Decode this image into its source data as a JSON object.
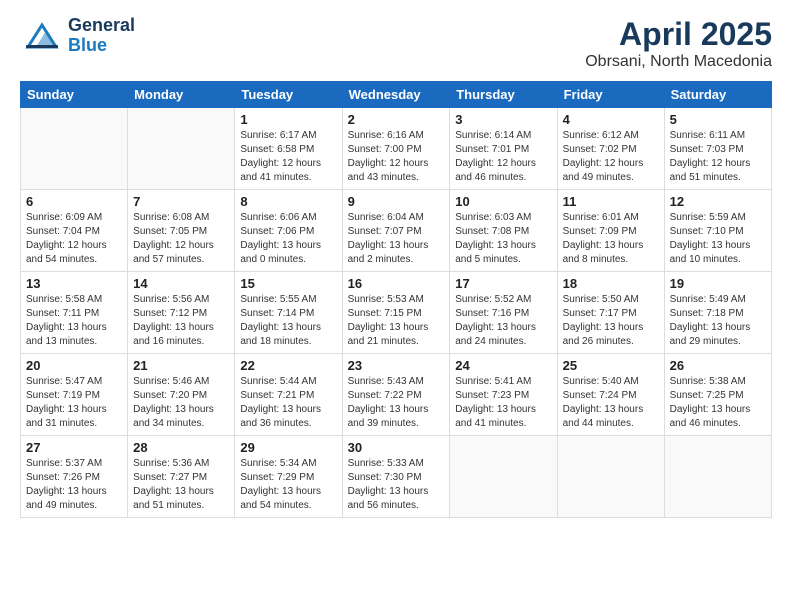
{
  "header": {
    "logo_general": "General",
    "logo_blue": "Blue",
    "month_title": "April 2025",
    "location": "Obrsani, North Macedonia"
  },
  "calendar": {
    "days_of_week": [
      "Sunday",
      "Monday",
      "Tuesday",
      "Wednesday",
      "Thursday",
      "Friday",
      "Saturday"
    ],
    "weeks": [
      [
        {
          "num": "",
          "detail": ""
        },
        {
          "num": "",
          "detail": ""
        },
        {
          "num": "1",
          "detail": "Sunrise: 6:17 AM\nSunset: 6:58 PM\nDaylight: 12 hours\nand 41 minutes."
        },
        {
          "num": "2",
          "detail": "Sunrise: 6:16 AM\nSunset: 7:00 PM\nDaylight: 12 hours\nand 43 minutes."
        },
        {
          "num": "3",
          "detail": "Sunrise: 6:14 AM\nSunset: 7:01 PM\nDaylight: 12 hours\nand 46 minutes."
        },
        {
          "num": "4",
          "detail": "Sunrise: 6:12 AM\nSunset: 7:02 PM\nDaylight: 12 hours\nand 49 minutes."
        },
        {
          "num": "5",
          "detail": "Sunrise: 6:11 AM\nSunset: 7:03 PM\nDaylight: 12 hours\nand 51 minutes."
        }
      ],
      [
        {
          "num": "6",
          "detail": "Sunrise: 6:09 AM\nSunset: 7:04 PM\nDaylight: 12 hours\nand 54 minutes."
        },
        {
          "num": "7",
          "detail": "Sunrise: 6:08 AM\nSunset: 7:05 PM\nDaylight: 12 hours\nand 57 minutes."
        },
        {
          "num": "8",
          "detail": "Sunrise: 6:06 AM\nSunset: 7:06 PM\nDaylight: 13 hours\nand 0 minutes."
        },
        {
          "num": "9",
          "detail": "Sunrise: 6:04 AM\nSunset: 7:07 PM\nDaylight: 13 hours\nand 2 minutes."
        },
        {
          "num": "10",
          "detail": "Sunrise: 6:03 AM\nSunset: 7:08 PM\nDaylight: 13 hours\nand 5 minutes."
        },
        {
          "num": "11",
          "detail": "Sunrise: 6:01 AM\nSunset: 7:09 PM\nDaylight: 13 hours\nand 8 minutes."
        },
        {
          "num": "12",
          "detail": "Sunrise: 5:59 AM\nSunset: 7:10 PM\nDaylight: 13 hours\nand 10 minutes."
        }
      ],
      [
        {
          "num": "13",
          "detail": "Sunrise: 5:58 AM\nSunset: 7:11 PM\nDaylight: 13 hours\nand 13 minutes."
        },
        {
          "num": "14",
          "detail": "Sunrise: 5:56 AM\nSunset: 7:12 PM\nDaylight: 13 hours\nand 16 minutes."
        },
        {
          "num": "15",
          "detail": "Sunrise: 5:55 AM\nSunset: 7:14 PM\nDaylight: 13 hours\nand 18 minutes."
        },
        {
          "num": "16",
          "detail": "Sunrise: 5:53 AM\nSunset: 7:15 PM\nDaylight: 13 hours\nand 21 minutes."
        },
        {
          "num": "17",
          "detail": "Sunrise: 5:52 AM\nSunset: 7:16 PM\nDaylight: 13 hours\nand 24 minutes."
        },
        {
          "num": "18",
          "detail": "Sunrise: 5:50 AM\nSunset: 7:17 PM\nDaylight: 13 hours\nand 26 minutes."
        },
        {
          "num": "19",
          "detail": "Sunrise: 5:49 AM\nSunset: 7:18 PM\nDaylight: 13 hours\nand 29 minutes."
        }
      ],
      [
        {
          "num": "20",
          "detail": "Sunrise: 5:47 AM\nSunset: 7:19 PM\nDaylight: 13 hours\nand 31 minutes."
        },
        {
          "num": "21",
          "detail": "Sunrise: 5:46 AM\nSunset: 7:20 PM\nDaylight: 13 hours\nand 34 minutes."
        },
        {
          "num": "22",
          "detail": "Sunrise: 5:44 AM\nSunset: 7:21 PM\nDaylight: 13 hours\nand 36 minutes."
        },
        {
          "num": "23",
          "detail": "Sunrise: 5:43 AM\nSunset: 7:22 PM\nDaylight: 13 hours\nand 39 minutes."
        },
        {
          "num": "24",
          "detail": "Sunrise: 5:41 AM\nSunset: 7:23 PM\nDaylight: 13 hours\nand 41 minutes."
        },
        {
          "num": "25",
          "detail": "Sunrise: 5:40 AM\nSunset: 7:24 PM\nDaylight: 13 hours\nand 44 minutes."
        },
        {
          "num": "26",
          "detail": "Sunrise: 5:38 AM\nSunset: 7:25 PM\nDaylight: 13 hours\nand 46 minutes."
        }
      ],
      [
        {
          "num": "27",
          "detail": "Sunrise: 5:37 AM\nSunset: 7:26 PM\nDaylight: 13 hours\nand 49 minutes."
        },
        {
          "num": "28",
          "detail": "Sunrise: 5:36 AM\nSunset: 7:27 PM\nDaylight: 13 hours\nand 51 minutes."
        },
        {
          "num": "29",
          "detail": "Sunrise: 5:34 AM\nSunset: 7:29 PM\nDaylight: 13 hours\nand 54 minutes."
        },
        {
          "num": "30",
          "detail": "Sunrise: 5:33 AM\nSunset: 7:30 PM\nDaylight: 13 hours\nand 56 minutes."
        },
        {
          "num": "",
          "detail": ""
        },
        {
          "num": "",
          "detail": ""
        },
        {
          "num": "",
          "detail": ""
        }
      ]
    ]
  }
}
